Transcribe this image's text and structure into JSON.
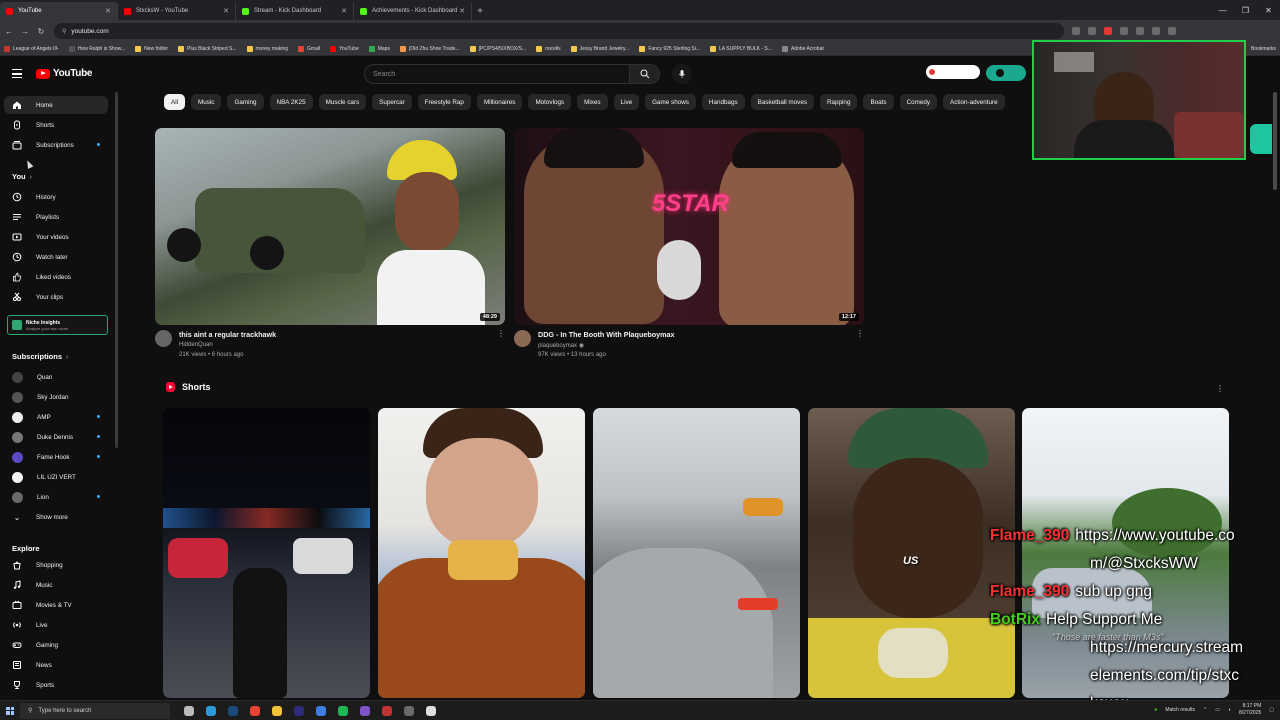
{
  "browser": {
    "tabs": [
      {
        "label": "YouTube",
        "color": "#ff0000"
      },
      {
        "label": "StxcksW - YouTube",
        "color": "#ff0000"
      },
      {
        "label": "Stream - Kick Dashboard",
        "color": "#53fc18"
      },
      {
        "label": "Achievements - Kick Dashboard",
        "color": "#53fc18"
      }
    ],
    "new_tab": "+",
    "url": "youtube.com",
    "bookmarks": [
      {
        "label": "League of Angels III-",
        "color": "#c0392b"
      },
      {
        "label": "How Ralph is Show...",
        "color": "#555555"
      },
      {
        "label": "New folder",
        "color": "#f2c94c"
      },
      {
        "label": "Plus Black Striped S...",
        "color": "#f2c94c"
      },
      {
        "label": "money making",
        "color": "#f2c94c"
      },
      {
        "label": "Gmail",
        "color": "#ea4335"
      },
      {
        "label": "YouTube",
        "color": "#ff0000"
      },
      {
        "label": "Maps",
        "color": "#34a853"
      },
      {
        "label": "[Old Zhu Shoe Trade...",
        "color": "#f2994a"
      },
      {
        "label": "[PC/PS4/5/XBOX/S...",
        "color": "#f2c94c"
      },
      {
        "label": "nocells",
        "color": "#f2c94c"
      },
      {
        "label": "Jessy Brand Jewelry...",
        "color": "#f2c94c"
      },
      {
        "label": "Fancy 925 Sterling Si...",
        "color": "#f2c94c"
      },
      {
        "label": "LA SUPPLY BULK - S...",
        "color": "#f2c94c"
      },
      {
        "label": "Adobe Acrobat",
        "color": "#888888"
      }
    ],
    "bookmarks_more": "Bookmarks"
  },
  "header": {
    "logo_text": "YouTube",
    "search_placeholder": "Search"
  },
  "sidebar": {
    "top": [
      {
        "label": "Home",
        "icon": "home-icon",
        "active": true
      },
      {
        "label": "Shorts",
        "icon": "shorts-icon"
      },
      {
        "label": "Subscriptions",
        "icon": "subscriptions-icon",
        "dot": true
      }
    ],
    "you_heading": "You",
    "you_items": [
      {
        "label": "History",
        "icon": "history-icon"
      },
      {
        "label": "Playlists",
        "icon": "playlists-icon"
      },
      {
        "label": "Your videos",
        "icon": "your-videos-icon"
      },
      {
        "label": "Watch later",
        "icon": "watch-later-icon"
      },
      {
        "label": "Liked videos",
        "icon": "liked-icon"
      },
      {
        "label": "Your clips",
        "icon": "clips-icon"
      }
    ],
    "niche": {
      "title": "Niche Insights",
      "subtitle": "Analyze your own niche"
    },
    "subs_heading": "Subscriptions",
    "subscriptions": [
      {
        "label": "Quan",
        "color": "#444444"
      },
      {
        "label": "Sky Jordan",
        "color": "#555555"
      },
      {
        "label": "AMP",
        "color": "#eeeeee",
        "dot": true
      },
      {
        "label": "Duke Dennis",
        "color": "#777777",
        "dot": true
      },
      {
        "label": "Fame Hook",
        "color": "#5a4bc2",
        "dot": true
      },
      {
        "label": "LIL UZI VERT",
        "color": "#f5f5f5"
      },
      {
        "label": "Lion",
        "color": "#6a6a6a",
        "dot": true
      }
    ],
    "show_more": "Show more",
    "explore_heading": "Explore",
    "explore": [
      {
        "label": "Shopping",
        "icon": "shopping-icon"
      },
      {
        "label": "Music",
        "icon": "music-icon"
      },
      {
        "label": "Movies & TV",
        "icon": "movies-icon"
      },
      {
        "label": "Live",
        "icon": "live-icon"
      },
      {
        "label": "Gaming",
        "icon": "gaming-icon"
      },
      {
        "label": "News",
        "icon": "news-icon"
      },
      {
        "label": "Sports",
        "icon": "sports-icon"
      }
    ]
  },
  "chips": [
    "All",
    "Music",
    "Gaming",
    "NBA 2K25",
    "Muscle cars",
    "Supercar",
    "Freestyle Rap",
    "Millionaires",
    "Motovlogs",
    "Mixes",
    "Live",
    "Game shows",
    "Handbags",
    "Basketball moves",
    "Rapping",
    "Boats",
    "Comedy",
    "Action-adventure"
  ],
  "videos": [
    {
      "title": "this aint a regular trackhawk",
      "channel": "HiddenQuan",
      "stats": "21K views • 6 hours ago",
      "duration": "48:29"
    },
    {
      "title": "DDG - In The Booth With Plaqueboymax",
      "channel": "plaqueboymax",
      "verified": "◉",
      "stats": "97K views • 13 hours ago",
      "duration": "12:17",
      "overlay": "5STAR"
    }
  ],
  "shorts": {
    "title": "Shorts"
  },
  "chat": {
    "lines": [
      {
        "user": "Flame_390",
        "msg": "https://www.youtube.co",
        "color": "red"
      },
      {
        "user": "",
        "msg": "m/@StxcksWW",
        "color": "red"
      },
      {
        "user": "Flame_390",
        "msg": "sub up gng",
        "color": "red"
      },
      {
        "user": "BotRix",
        "msg": "Help Support Me",
        "color": "green"
      },
      {
        "user": "",
        "msg": "https://mercury.stream",
        "color": "green"
      },
      {
        "user": "",
        "msg": "elements.com/tip/stxc",
        "color": "green"
      },
      {
        "user": "",
        "msg": "ksww",
        "color": "green"
      }
    ],
    "quote": "\"Those are faster than M3s\"",
    "us_text": "US"
  },
  "taskbar": {
    "search_placeholder": "Type here to search",
    "tray_text": "Match results",
    "time": "8:17 PM",
    "date": "8/27/2025"
  }
}
